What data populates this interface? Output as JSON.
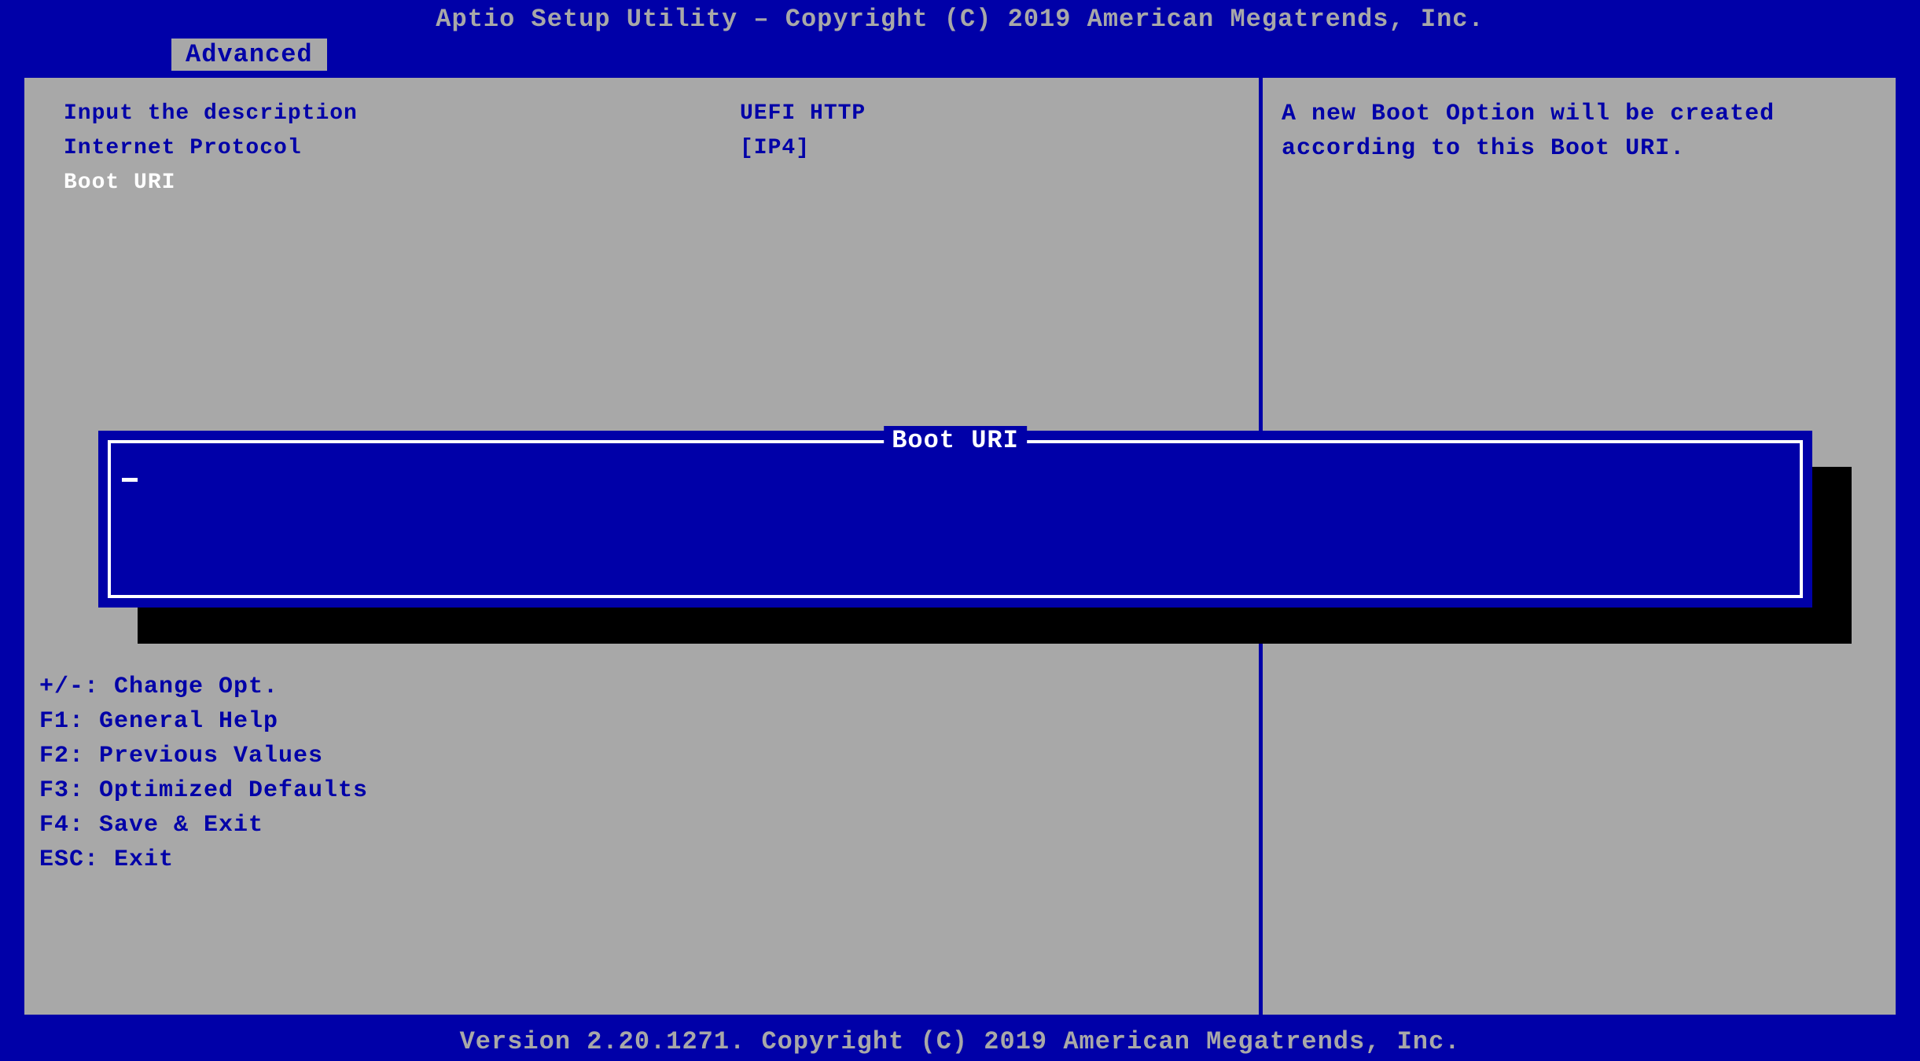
{
  "header": {
    "title": "Aptio Setup Utility – Copyright (C) 2019 American Megatrends, Inc."
  },
  "tabs": {
    "active": "Advanced"
  },
  "settings": [
    {
      "label": "Input the description",
      "value": "UEFI HTTP",
      "selected": false
    },
    {
      "label": "Internet Protocol",
      "value": "[IP4]",
      "selected": false
    },
    {
      "label": "Boot URI",
      "value": "",
      "selected": true
    }
  ],
  "help": {
    "text": "A new Boot Option will be created according to this Boot URI."
  },
  "keys": [
    "+/-: Change Opt.",
    "F1: General Help",
    "F2: Previous Values",
    "F3: Optimized Defaults",
    "F4: Save & Exit",
    "ESC: Exit"
  ],
  "dialog": {
    "title": " Boot URI ",
    "value": ""
  },
  "footer": {
    "text": "Version 2.20.1271. Copyright (C) 2019 American Megatrends, Inc."
  }
}
